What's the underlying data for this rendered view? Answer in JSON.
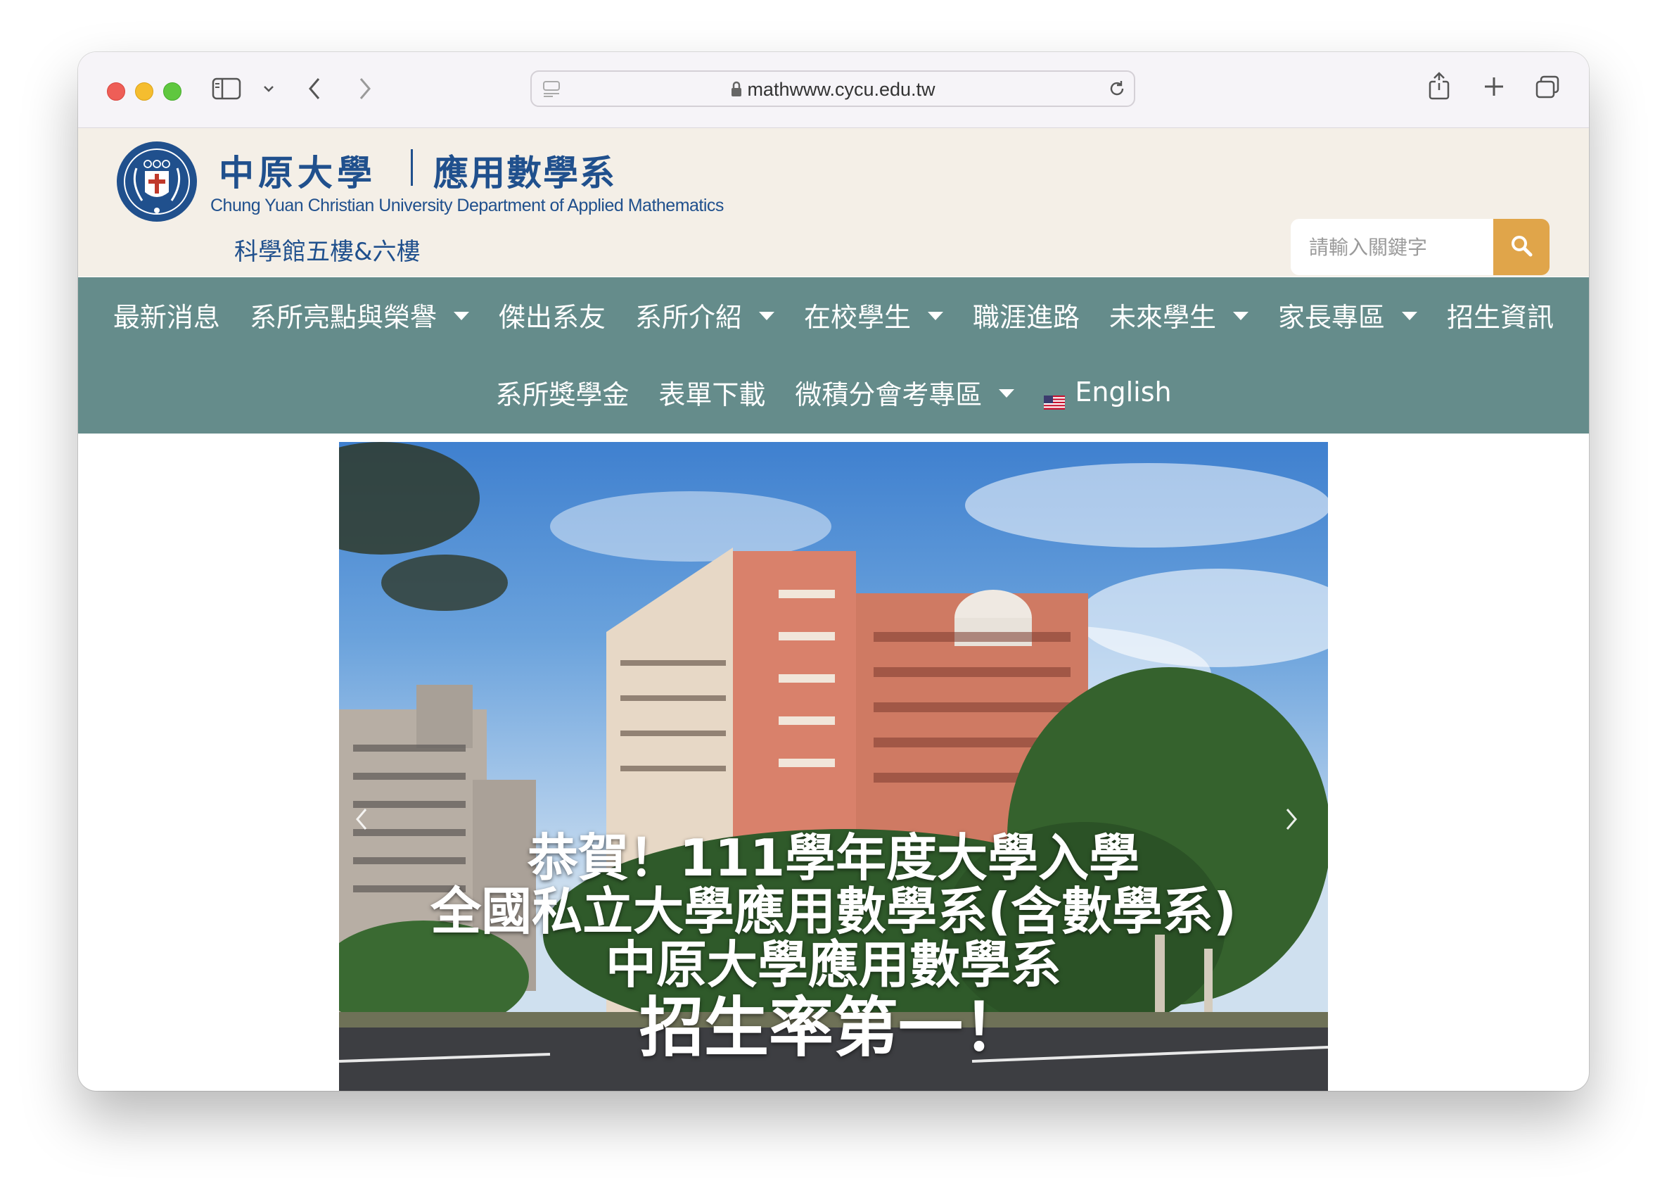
{
  "browser": {
    "url": "mathwww.cycu.edu.tw",
    "traffic_lights": [
      "close",
      "minimize",
      "zoom"
    ],
    "toolbar_icons": [
      "sidebar-icon",
      "chevron-down-icon",
      "back-icon",
      "forward-icon",
      "page-menu-icon",
      "lock-icon",
      "reload-icon",
      "share-icon",
      "new-tab-icon",
      "tabs-overview-icon"
    ]
  },
  "header": {
    "university_cn": "中原大學",
    "department_cn": "應用數學系",
    "department_en": "Chung Yuan Christian University Department of Applied Mathematics",
    "location": "科學館五樓&六樓",
    "search_placeholder": "請輸入關鍵字",
    "colors": {
      "title": "#20508d",
      "header_bg": "#f4efe7",
      "search_button": "#e0a54a"
    }
  },
  "nav": {
    "row1": [
      {
        "label": "最新消息",
        "dropdown": false
      },
      {
        "label": "系所亮點與榮譽",
        "dropdown": true
      },
      {
        "label": "傑出系友",
        "dropdown": false
      },
      {
        "label": "系所介紹",
        "dropdown": true
      },
      {
        "label": "在校學生",
        "dropdown": true
      },
      {
        "label": "職涯進路",
        "dropdown": false
      },
      {
        "label": "未來學生",
        "dropdown": true
      },
      {
        "label": "家長專區",
        "dropdown": true
      },
      {
        "label": "招生資訊",
        "dropdown": false
      }
    ],
    "row2": [
      {
        "label": "系所獎學金",
        "dropdown": false
      },
      {
        "label": "表單下載",
        "dropdown": false
      },
      {
        "label": "微積分會考專區",
        "dropdown": true
      },
      {
        "label": "English",
        "dropdown": false,
        "flag": "us"
      }
    ],
    "colors": {
      "bg": "#658c8b",
      "text": "#ffffff"
    }
  },
  "hero": {
    "caption_lines": [
      "恭賀！111學年度大學入學",
      "全國私立大學應用數學系(含數學系)",
      "中原大學應用數學系",
      "招生率第一！"
    ]
  }
}
